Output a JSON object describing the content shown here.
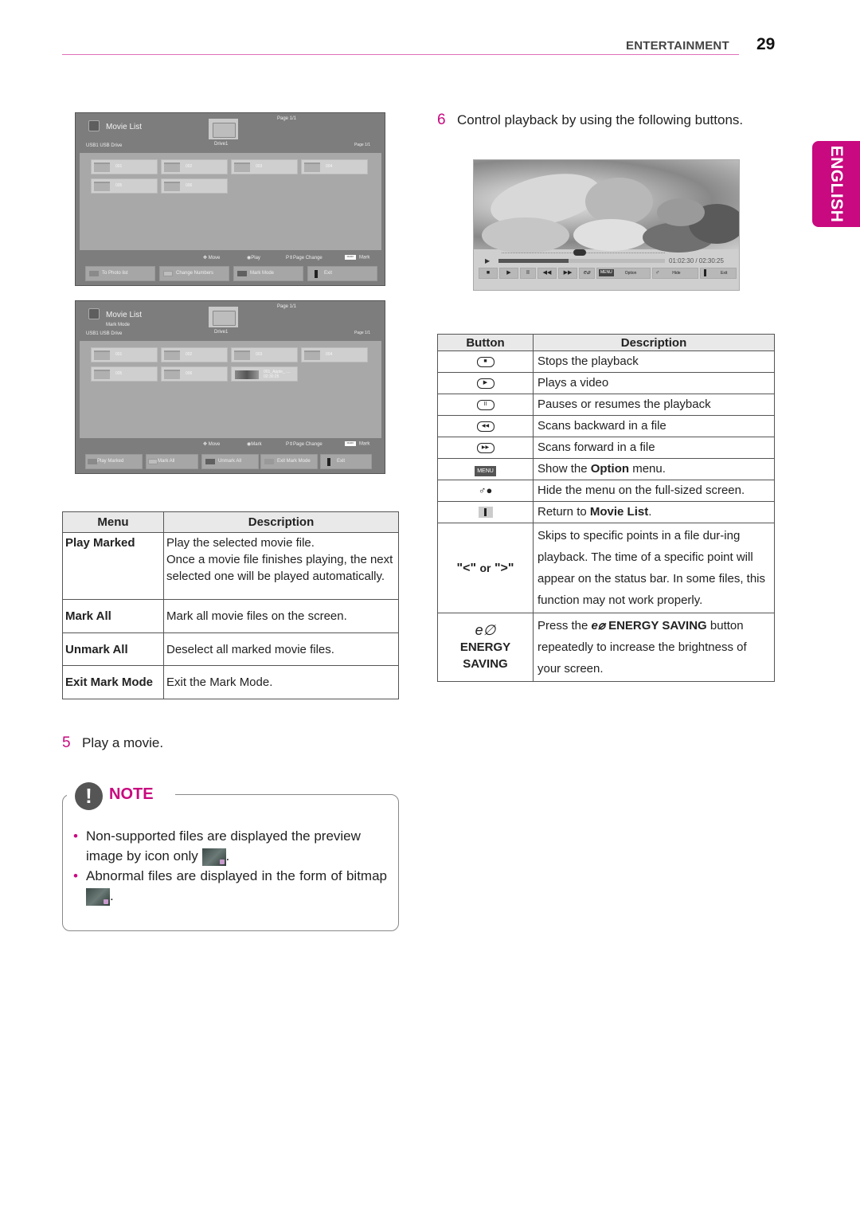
{
  "header": {
    "section": "ENTERTAINMENT",
    "page_number": "29",
    "language_tab": "ENGLISH"
  },
  "screen1": {
    "title": "Movie List",
    "page_top": "Page 1/1",
    "source": "USB1   USB Drive",
    "drive": "Drive1",
    "page_right": "Page 1/1",
    "files": [
      "001",
      "002",
      "003",
      "004",
      "005",
      "006"
    ],
    "hints": {
      "move": "Move",
      "play": "Play",
      "page_change": "Page Change",
      "mark": "Mark",
      "mark_badge": "MARK",
      "p": "P"
    },
    "buttons": [
      {
        "label": "To Photo list",
        "color": "#8a8a8a"
      },
      {
        "label": "Change Numbers",
        "color": "#bdbdbd"
      },
      {
        "label": "Mark Mode",
        "color": "#606060"
      },
      {
        "label": "Exit",
        "color": "#222222"
      }
    ]
  },
  "screen2": {
    "title": "Movie List",
    "subtitle": "Mark Mode",
    "page_top": "Page 1/1",
    "source": "USB1   USB Drive",
    "drive": "Drive1",
    "page_right": "Page 1/1",
    "files": [
      "001",
      "002",
      "003",
      "004",
      "005",
      "006"
    ],
    "video_file": {
      "name": "001_Apple_ ....",
      "duration": "02:30:25"
    },
    "hints": {
      "move": "Move",
      "mark_action": "Mark",
      "page_change": "Page Change",
      "mark": "Mark",
      "mark_badge": "MARK",
      "p": "P"
    },
    "buttons": [
      {
        "label": "Play Marked",
        "color": "#8a8a8a"
      },
      {
        "label": "Mark All",
        "color": "#bdbdbd"
      },
      {
        "label": "Unmark All",
        "color": "#606060"
      },
      {
        "label": "Exit Mark Mode",
        "color": "#999999"
      },
      {
        "label": "Exit",
        "color": "#222222"
      }
    ]
  },
  "menu_table": {
    "headers": [
      "Menu",
      "Description"
    ],
    "rows": [
      {
        "menu": "Play Marked",
        "description": "Play the selected movie file.\nOnce a movie file finishes playing, the next selected one will be played automatically."
      },
      {
        "menu": "Mark All",
        "description": "Mark all movie files on the screen."
      },
      {
        "menu": "Unmark All",
        "description": "Deselect all marked movie files."
      },
      {
        "menu": "Exit Mark Mode",
        "description": "Exit the Mark Mode."
      }
    ]
  },
  "step5": {
    "number": "5",
    "text": "Play a movie."
  },
  "note": {
    "title": "NOTE",
    "items": [
      {
        "text": "Non-supported files are displayed the preview image by icon only",
        "icon": "unsupported-file-icon"
      },
      {
        "text": "Abnormal files are displayed in the form of bitmap",
        "icon": "abnormal-file-icon"
      }
    ]
  },
  "step6": {
    "number": "6",
    "text": "Control playback by using the following buttons."
  },
  "player": {
    "progress": 0.42,
    "time": "01:02:30 / 02:30:25",
    "controls": {
      "stop": "■",
      "play": "▶",
      "pause": "II",
      "rew": "◀◀",
      "ff": "▶▶",
      "menu_badge": "MENU",
      "option": "Option",
      "hide": "Hide",
      "exit": "Exit"
    }
  },
  "button_table": {
    "headers": [
      "Button",
      "Description"
    ],
    "rows": [
      {
        "icon": "stop-button-icon",
        "glyph": "■",
        "description": "Stops the playback"
      },
      {
        "icon": "play-button-icon",
        "glyph": "▶",
        "description": "Plays a video"
      },
      {
        "icon": "pause-button-icon",
        "glyph": "II",
        "description": "Pauses or resumes the playback"
      },
      {
        "icon": "rewind-button-icon",
        "glyph": "◀◀",
        "description": "Scans backward in a file"
      },
      {
        "icon": "fast-forward-button-icon",
        "glyph": "▶▶",
        "description": "Scans forward in a file"
      },
      {
        "icon": "menu-button-icon",
        "glyph": "MENU",
        "description_pre": "Show the ",
        "description_bold": "Option",
        "description_post": " menu."
      },
      {
        "icon": "hide-button-icon",
        "glyph": "♂●",
        "description": "Hide the menu on the full-sized screen."
      },
      {
        "icon": "exit-button-icon",
        "glyph": "",
        "description_pre": "Return to ",
        "description_bold": "Movie List",
        "description_post": "."
      },
      {
        "label": "\"<\" or \">\"",
        "label_quote_l": "\"<\"",
        "label_or": "or",
        "label_quote_r": "\">\"",
        "description": "Skips to specific points in a file dur-ing playback. The time of a specific point will appear on the status bar. In some files, this function may not work properly."
      },
      {
        "icon": "energy-saving-icon",
        "glyph": "e∅",
        "label": "ENERGY SAVING",
        "description_pre": "Press the ",
        "description_bold": "ENERGY SAVING",
        "description_post": " button repeatedly to increase the brightness of your screen."
      }
    ]
  }
}
